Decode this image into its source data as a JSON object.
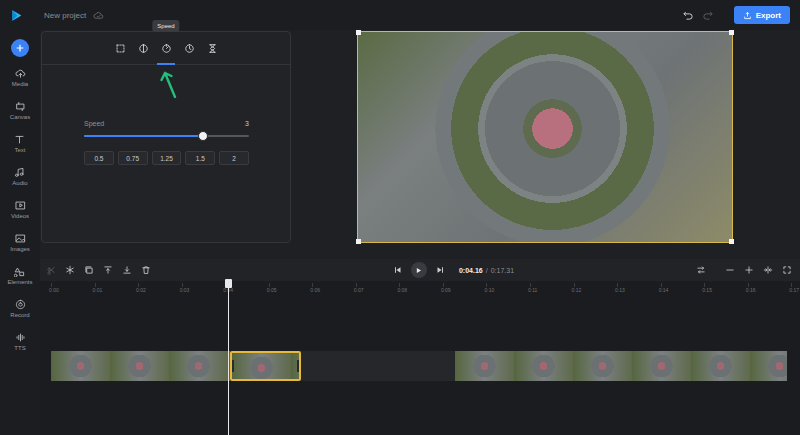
{
  "topbar": {
    "project_name": "New project",
    "export_label": "Export",
    "history": [
      {
        "disabled": false
      },
      {
        "disabled": true
      }
    ]
  },
  "sidebar": {
    "items": [
      {
        "label": "Media"
      },
      {
        "label": "Canvas"
      },
      {
        "label": "Text"
      },
      {
        "label": "Audio"
      },
      {
        "label": "Videos"
      },
      {
        "label": "Images"
      },
      {
        "label": "Elements"
      },
      {
        "label": "Record"
      },
      {
        "label": "TTS"
      }
    ]
  },
  "panel": {
    "tabs": [
      {
        "selected": false,
        "hovered": false
      },
      {
        "selected": false,
        "hovered": false
      },
      {
        "selected": true,
        "hovered": true
      },
      {
        "selected": false,
        "hovered": false
      },
      {
        "selected": false,
        "hovered": false
      }
    ],
    "tooltip": "Speed",
    "speed": {
      "label": "Speed",
      "value": "3",
      "level": 0.72,
      "presets": [
        "0.5",
        "0.75",
        "1.25",
        "1.5",
        "2"
      ]
    }
  },
  "timeline": {
    "tools": [
      {
        "disabled": true
      },
      {
        "disabled": false
      },
      {
        "disabled": false
      },
      {
        "disabled": false
      },
      {
        "disabled": false
      },
      {
        "disabled": false
      }
    ],
    "current_time": "0:04.16",
    "separator": "/",
    "duration": "0:17.31",
    "ruler": [
      "0:00",
      "0:01",
      "0:02",
      "0:03",
      "0:04",
      "0:05",
      "0:06",
      "0:07",
      "0:08",
      "0:09",
      "0:10",
      "0:11",
      "0:12",
      "0:13",
      "0:14",
      "0:15",
      "0:16",
      "0:17"
    ],
    "segments": [
      {
        "kind": "clip",
        "selected": false
      },
      {
        "kind": "clip",
        "selected": true
      },
      {
        "kind": "gap",
        "selected": false
      },
      {
        "kind": "clip",
        "selected": false
      }
    ]
  }
}
